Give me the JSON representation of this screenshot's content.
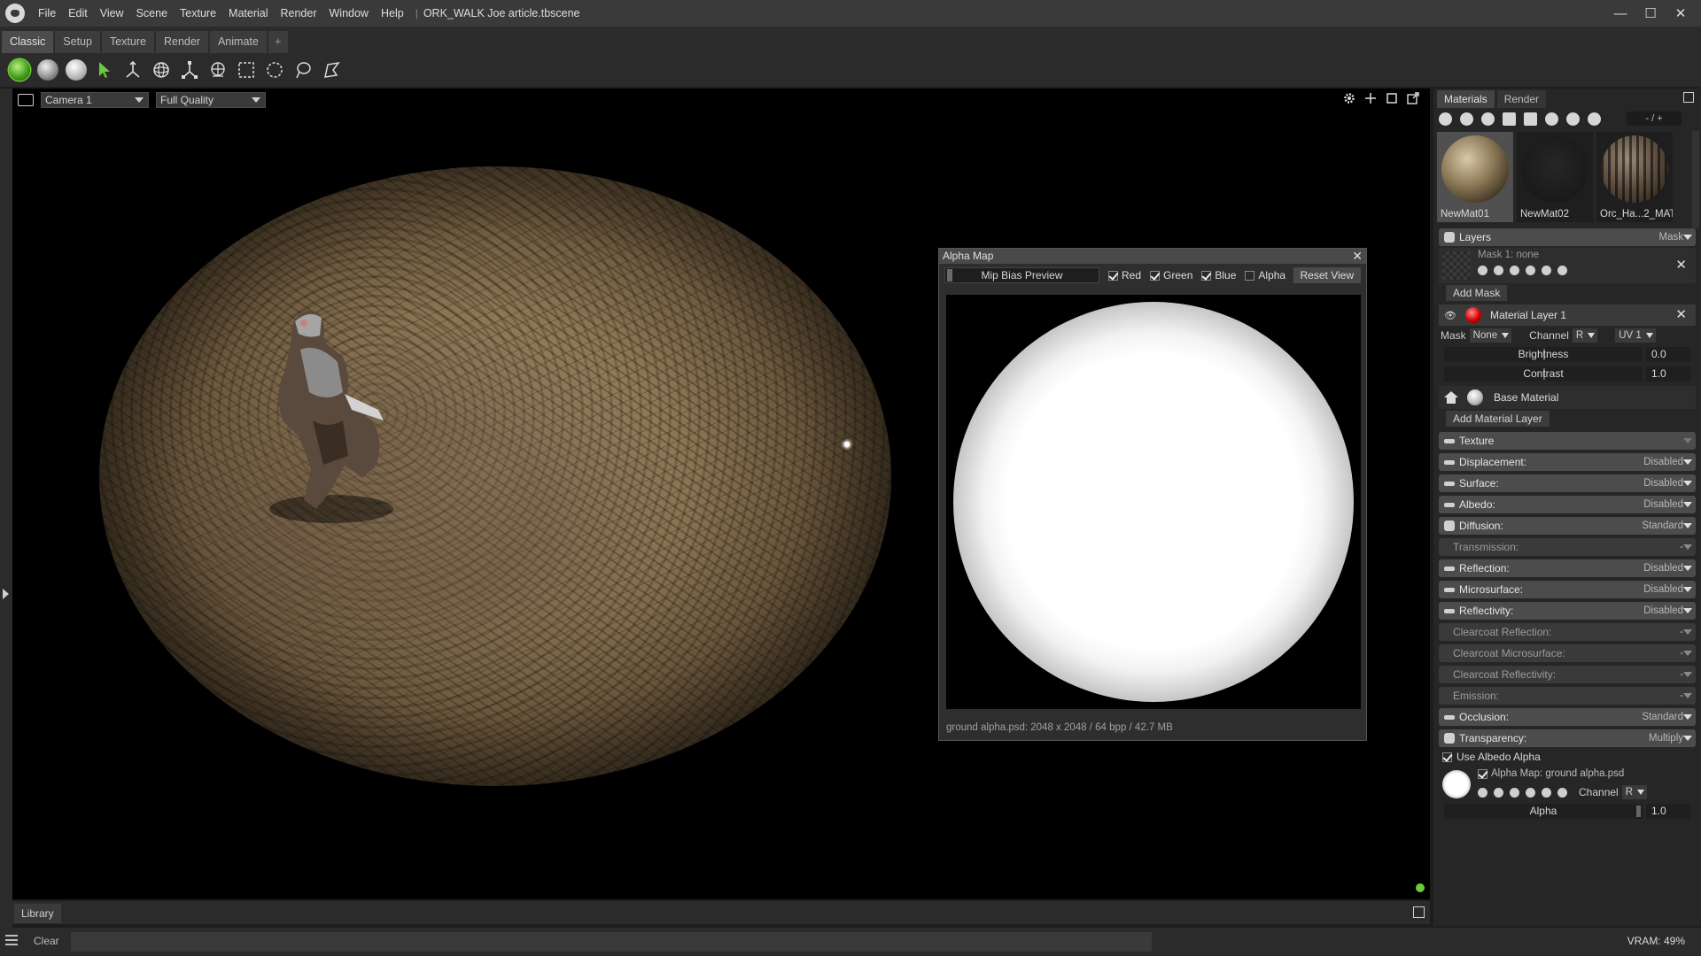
{
  "title_bar": {
    "menu": [
      "File",
      "Edit",
      "View",
      "Scene",
      "Texture",
      "Material",
      "Render",
      "Window",
      "Help"
    ],
    "document": "ORK_WALK Joe article.tbscene",
    "controls": [
      "—",
      "☐",
      "✕"
    ]
  },
  "workspace_tabs": [
    "Classic",
    "Setup",
    "Texture",
    "Render",
    "Animate",
    "+"
  ],
  "viewport": {
    "camera": "Camera 1",
    "quality": "Full Quality"
  },
  "alpha_map_window": {
    "title": "Alpha Map",
    "close": "✕",
    "mip_bias_label": "Mip Bias Preview",
    "channels": [
      {
        "label": "Red",
        "checked": true
      },
      {
        "label": "Green",
        "checked": true
      },
      {
        "label": "Blue",
        "checked": true
      },
      {
        "label": "Alpha",
        "checked": false
      }
    ],
    "reset_label": "Reset View",
    "info": "ground alpha.psd:  2048 x 2048 / 64 bpp / 42.7 MB"
  },
  "library": {
    "tab": "Library"
  },
  "status_bar": {
    "clear": "Clear",
    "vram": "VRAM: 49%"
  },
  "right_panel": {
    "tabs": [
      "Materials",
      "Render"
    ],
    "zoom": "- / +",
    "materials": [
      {
        "name": "NewMat01",
        "selected": true
      },
      {
        "name": "NewMat02",
        "selected": false
      },
      {
        "name": "Orc_Ha...2_MAT",
        "selected": false
      }
    ],
    "layers": {
      "title": "Layers",
      "mode": "Mask",
      "mask_text": "Mask 1: none",
      "add_mask": "Add Mask",
      "layer_name": "Material Layer 1",
      "mask_label": "Mask",
      "mask_value": "None",
      "channel_label": "Channel",
      "channel_value": "R",
      "uv_value": "UV 1",
      "brightness_label": "Brightness",
      "brightness_value": "0.0",
      "contrast_label": "Contrast",
      "contrast_value": "1.0",
      "base_material": "Base Material",
      "add_material_layer": "Add Material Layer"
    },
    "modules": [
      {
        "label": "Texture",
        "value": "",
        "active": true
      },
      {
        "label": "Displacement:",
        "value": "Disabled",
        "active": true
      },
      {
        "label": "Surface:",
        "value": "Disabled",
        "active": true
      },
      {
        "label": "Albedo:",
        "value": "Disabled",
        "active": true
      },
      {
        "label": "Diffusion:",
        "value": "Standard",
        "active": true
      },
      {
        "label": "Transmission:",
        "value": "-",
        "active": false
      },
      {
        "label": "Reflection:",
        "value": "Disabled",
        "active": true
      },
      {
        "label": "Microsurface:",
        "value": "Disabled",
        "active": true
      },
      {
        "label": "Reflectivity:",
        "value": "Disabled",
        "active": true
      },
      {
        "label": "Clearcoat Reflection:",
        "value": "-",
        "active": false
      },
      {
        "label": "Clearcoat Microsurface:",
        "value": "-",
        "active": false
      },
      {
        "label": "Clearcoat Reflectivity:",
        "value": "-",
        "active": false
      },
      {
        "label": "Emission:",
        "value": "-",
        "active": false
      },
      {
        "label": "Occlusion:",
        "value": "Standard",
        "active": true
      },
      {
        "label": "Transparency:",
        "value": "Multiply",
        "active": true
      }
    ],
    "transparency": {
      "use_albedo_alpha": "Use Albedo Alpha",
      "alpha_map": "Alpha Map: ground alpha.psd",
      "channel_label": "Channel",
      "channel_value": "R",
      "alpha_label": "Alpha",
      "alpha_value": "1.0"
    }
  },
  "colors": {
    "accent_green": "#6ccb3c",
    "panel": "#262626",
    "viewport": "#000000"
  }
}
